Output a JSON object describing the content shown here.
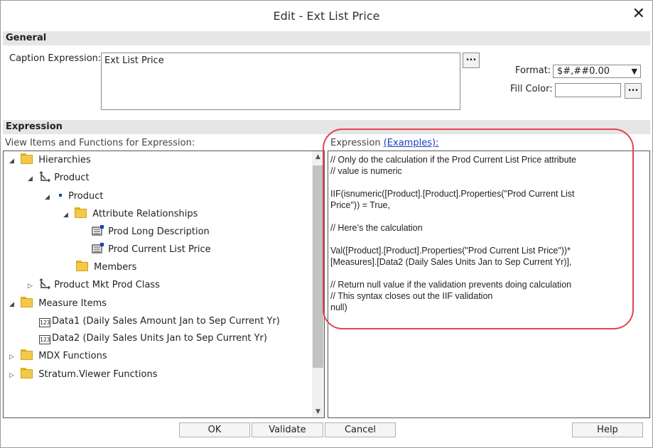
{
  "dialog": {
    "title": "Edit - Ext List Price",
    "close_label": "✕"
  },
  "general": {
    "section_label": "General",
    "caption_label": "Caption Expression:",
    "caption_value": "Ext List Price",
    "caption_button_label": "...",
    "format_label": "Format:",
    "format_value": "$#,##0.00",
    "fill_color_label": "Fill Color:",
    "fill_color_value": "",
    "fill_button_label": "..."
  },
  "expression": {
    "section_label": "Expression",
    "tree_heading": "View Items and Functions for Expression:",
    "expr_heading": "Expression",
    "examples_link": "(Examples):",
    "tree": [
      {
        "label": "Hierarchies",
        "icon": "folder-icon",
        "expander": "expanded"
      },
      {
        "label": "Product",
        "icon": "hierarchy-icon",
        "expander": "expanded"
      },
      {
        "label": "Product",
        "icon": "level-dot-icon",
        "expander": "expanded"
      },
      {
        "label": "Attribute Relationships",
        "icon": "folder-icon",
        "expander": "expanded"
      },
      {
        "label": "Prod Long Description",
        "icon": "attribute-icon",
        "expander": "none"
      },
      {
        "label": "Prod Current List Price",
        "icon": "attribute-icon",
        "expander": "none"
      },
      {
        "label": "Members",
        "icon": "folder-icon",
        "expander": "none"
      },
      {
        "label": "Product Mkt Prod Class",
        "icon": "hierarchy-icon",
        "expander": "collapsed"
      },
      {
        "label": "Measure Items",
        "icon": "folder-icon",
        "expander": "expanded"
      },
      {
        "label": "Data1 (Daily Sales Amount Jan to Sep Current Yr)",
        "icon": "measure-icon",
        "expander": "none"
      },
      {
        "label": "Data2 (Daily Sales Units Jan to Sep Current Yr)",
        "icon": "measure-icon",
        "expander": "none"
      },
      {
        "label": "MDX Functions",
        "icon": "folder-icon",
        "expander": "collapsed"
      },
      {
        "label": "Stratum.Viewer Functions",
        "icon": "folder-icon",
        "expander": "collapsed"
      }
    ],
    "measure_icon_text": "123",
    "code": "// Only do the calculation if the Prod Current List Price attribute\n// value is numeric\n\nIIF(isnumeric([Product].[Product].Properties(\"Prod Current List\nPrice\")) = True,\n\n// Here’s the calculation\n\nVal([Product].[Product].Properties(\"Prod Current List Price\"))*\n[Measures].[Data2 (Daily Sales Units Jan to Sep Current Yr)],\n\n// Return null value if the validation prevents doing calculation\n// This syntax closes out the IIF validation\nnull)"
  },
  "buttons": {
    "ok": "OK",
    "validate": "Validate",
    "cancel": "Cancel",
    "help": "Help"
  },
  "colors": {
    "highlight_ring": "#e0454f",
    "link": "#1a3fbf",
    "section_bar": "#e6e6e6"
  }
}
